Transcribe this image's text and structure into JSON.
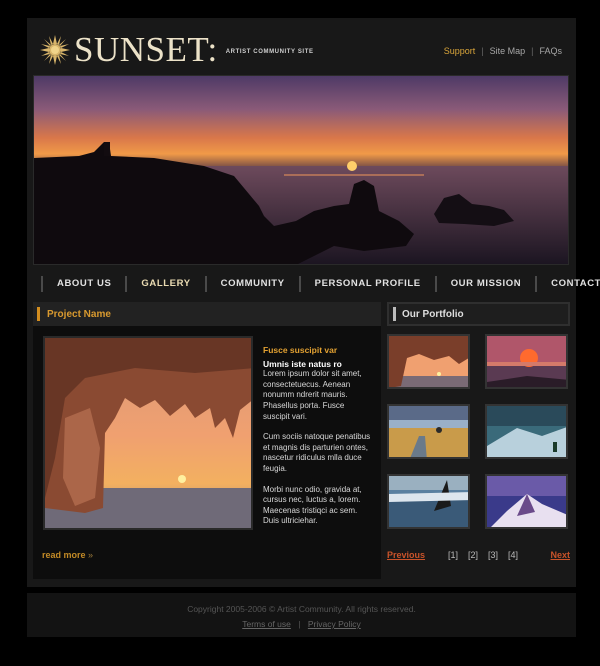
{
  "header": {
    "logo_text": "SUNSET:",
    "tagline": "ARTIST COMMUNITY SITE",
    "links": {
      "support": "Support",
      "sitemap": "Site Map",
      "faqs": "FAQs",
      "separator": "|"
    }
  },
  "nav": {
    "items": [
      "ABOUT US",
      "GALLERY",
      "COMMUNITY",
      "PERSONAL PROFILE",
      "OUR MISSION",
      "CONTACTS"
    ],
    "active": "GALLERY"
  },
  "main": {
    "title": "Project Name",
    "heading1": "Fusce suscipit var",
    "heading2": "Umnis iste natus ro",
    "para1": "Lorem ipsum dolor sit amet, consectetuecus. Aenean nonumm ndrerit mauris. Phasellus porta. Fusce suscipit vari.",
    "para2": "Cum sociis natoque penatibus et magnis dis parturien ontes, nascetur ridiculus mlla duce feugia.",
    "para3": "Morbi nunc odio, gravida at, cursus nec, luctus a, lorem. Maecenas tristiqci ac sem. Duis ultriciehar.",
    "read_more": "read more",
    "read_more_arrow": "»"
  },
  "portfolio": {
    "title": "Our Portfolio",
    "prev": "Previous",
    "next": "Next",
    "pages": [
      "[1]",
      "[2]",
      "[3]",
      "[4]"
    ]
  },
  "footer": {
    "copyright": "Copyright 2005-2006 © Artist Community. All rights reserved.",
    "terms": "Terms of use",
    "separator": "|",
    "privacy": "Privacy Policy"
  },
  "colors": {
    "accent": "#d99a2f",
    "pager_link": "#c9532a",
    "background": "#000000"
  }
}
